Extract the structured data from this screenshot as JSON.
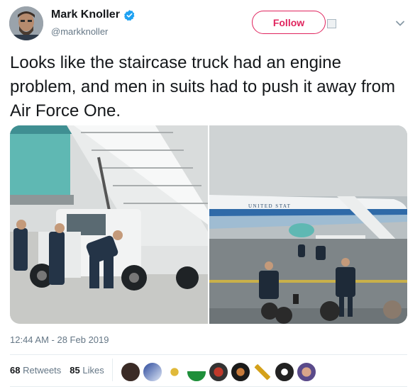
{
  "author": {
    "name": "Mark Knoller",
    "handle": "@markknoller",
    "verified": true
  },
  "actions": {
    "follow_label": "Follow"
  },
  "tweet": {
    "text": "Looks like the staircase truck had an engine problem, and men in suits had to push it away from Air Force One.",
    "timestamp": "12:44 AM - 28 Feb 2019"
  },
  "media": {
    "photo_right_plane_lettering": "UNITED STAT"
  },
  "stats": {
    "retweets_count": "68",
    "retweets_label": "Retweets",
    "likes_count": "85",
    "likes_label": "Likes"
  },
  "colors": {
    "follow_accent": "#e0245e",
    "verified_badge": "#1da1f2",
    "secondary_text": "#657786",
    "divider": "#e6ecf0"
  },
  "icons": [
    "verified-badge-icon",
    "qr-code-icon",
    "chevron-down-icon"
  ]
}
